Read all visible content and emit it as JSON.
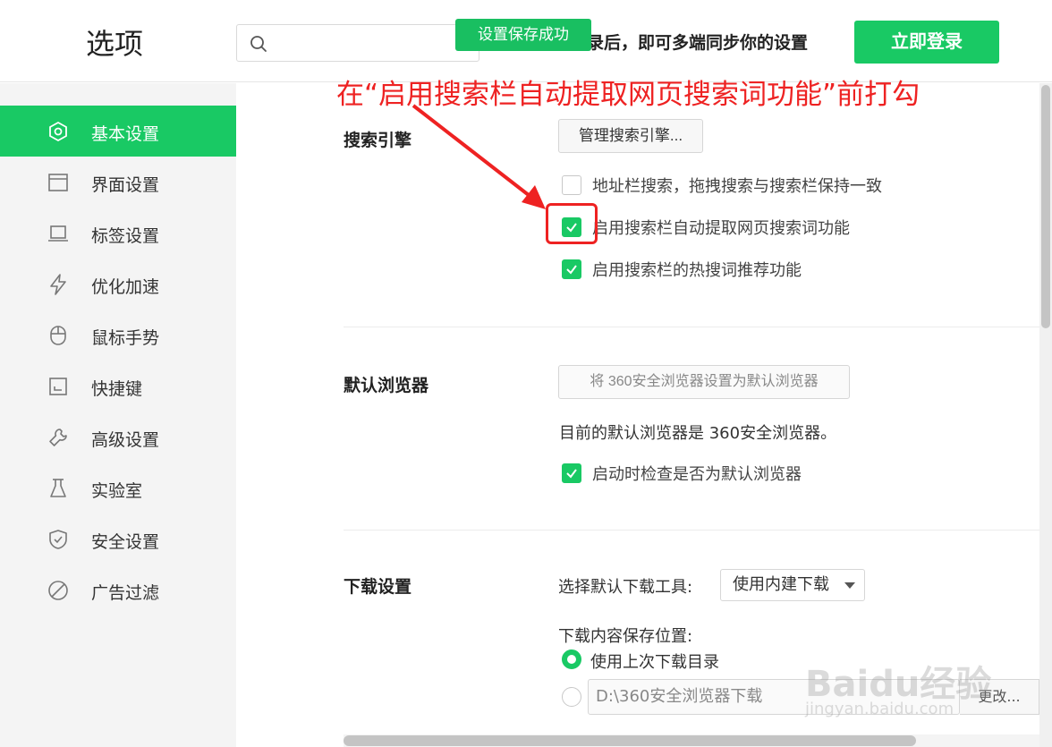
{
  "header": {
    "title": "选项",
    "search_placeholder": "",
    "toast": "设置保存成功",
    "login_tip": "录后，即可多端同步你的设置",
    "login_button": "立即登录"
  },
  "sidebar": {
    "items": [
      {
        "label": "基本设置",
        "icon": "hexagon-settings-icon",
        "active": true
      },
      {
        "label": "界面设置",
        "icon": "window-icon",
        "active": false
      },
      {
        "label": "标签设置",
        "icon": "tab-icon",
        "active": false
      },
      {
        "label": "优化加速",
        "icon": "lightning-icon",
        "active": false
      },
      {
        "label": "鼠标手势",
        "icon": "mouse-icon",
        "active": false
      },
      {
        "label": "快捷键",
        "icon": "keyboard-shortcut-icon",
        "active": false
      },
      {
        "label": "高级设置",
        "icon": "wrench-icon",
        "active": false
      },
      {
        "label": "实验室",
        "icon": "flask-icon",
        "active": false
      },
      {
        "label": "安全设置",
        "icon": "shield-icon",
        "active": false
      },
      {
        "label": "广告过滤",
        "icon": "block-icon",
        "active": false
      }
    ]
  },
  "search_engine": {
    "title": "搜索引擎",
    "manage_button": "管理搜索引擎...",
    "options": [
      {
        "label": "地址栏搜索，拖拽搜索与搜索栏保持一致",
        "checked": false
      },
      {
        "label": "启用搜索栏自动提取网页搜索词功能",
        "checked": true
      },
      {
        "label": "启用搜索栏的热搜词推荐功能",
        "checked": true
      }
    ]
  },
  "default_browser": {
    "title": "默认浏览器",
    "set_default_button": "将 360安全浏览器设置为默认浏览器",
    "status_text": "目前的默认浏览器是 360安全浏览器。",
    "check_on_startup": {
      "label": "启动时检查是否为默认浏览器",
      "checked": true
    }
  },
  "download": {
    "title": "下载设置",
    "tool_label": "选择默认下载工具:",
    "tool_value": "使用内建下载",
    "location_label": "下载内容保存位置:",
    "options": [
      {
        "label": "使用上次下载目录",
        "checked": true
      },
      {
        "label": "",
        "checked": false
      }
    ],
    "path_value": "D:\\360安全浏览器下载",
    "change_button": "更改..."
  },
  "annotation": {
    "text": "在“启用搜索栏自动提取网页搜索词功能”前打勾",
    "color": "#ee2222"
  },
  "watermark": {
    "text": "Baidu经验",
    "sub": "jingyan.baidu.com"
  },
  "colors": {
    "accent": "#19c964",
    "annotation": "#ee2222"
  }
}
